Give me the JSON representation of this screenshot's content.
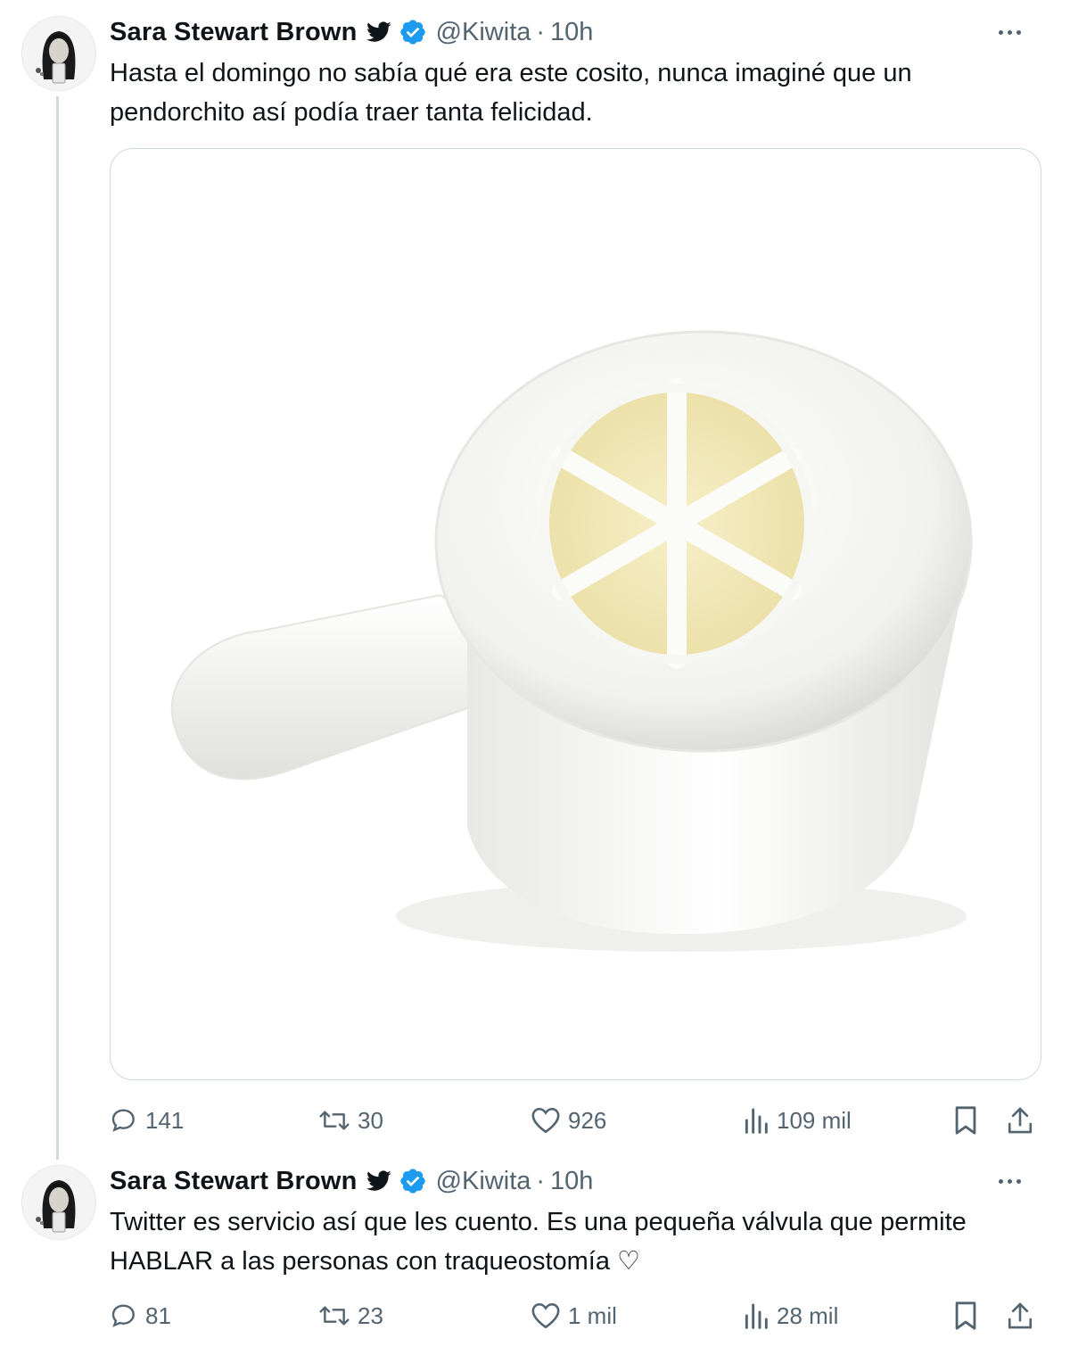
{
  "tweets": [
    {
      "author_name": "Sara Stewart Brown",
      "handle": "@Kiwita",
      "separator": "·",
      "time": "10h",
      "text": "Hasta el domingo no sabía qué era este cosito, nunca imaginé que un pendorchito así podía traer tanta felicidad.",
      "media_description_icon": "speaking-valve-photo",
      "replies": "141",
      "retweets": "30",
      "likes": "926",
      "views": "109 mil"
    },
    {
      "author_name": "Sara Stewart Brown",
      "handle": "@Kiwita",
      "separator": "·",
      "time": "10h",
      "text": "Twitter es servicio así que les cuento. Es una pequeña válvula que permite HABLAR a las personas con traqueostomía ♡",
      "replies": "81",
      "retweets": "23",
      "likes": "1 mil",
      "views": "28 mil"
    }
  ],
  "icons": {
    "bird": "twitter-bird-icon",
    "verified": "verified-badge-icon",
    "more": "more-options-icon",
    "reply": "reply-icon",
    "retweet": "retweet-icon",
    "like": "heart-icon",
    "views": "views-chart-icon",
    "bookmark": "bookmark-icon",
    "share": "share-icon"
  },
  "colors": {
    "text": "#0f1419",
    "secondary": "#536471",
    "verified": "#1d9bf0",
    "border": "#cfd9de"
  }
}
